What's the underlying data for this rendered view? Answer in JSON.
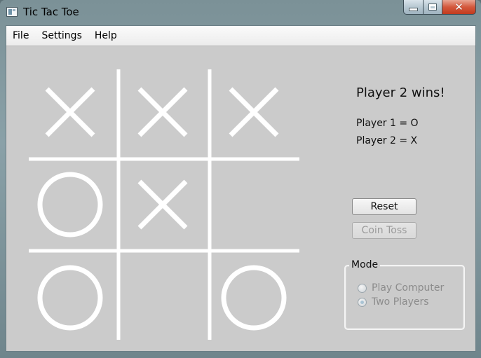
{
  "window": {
    "title": "Tic Tac Toe",
    "icon": "app-window-icon"
  },
  "menu": {
    "items": [
      "File",
      "Settings",
      "Help"
    ]
  },
  "board": {
    "cells": [
      [
        "X",
        "X",
        "X"
      ],
      [
        "O",
        "X",
        ""
      ],
      [
        "O",
        "",
        "O"
      ]
    ],
    "line_color": "#ffffff"
  },
  "status": {
    "message": "Player 2 wins!",
    "player1": "Player 1 = O",
    "player2": "Player 2 = X"
  },
  "buttons": {
    "reset": "Reset",
    "coin_toss": "Coin Toss"
  },
  "mode": {
    "legend": "Mode",
    "options": [
      {
        "label": "Play Computer",
        "selected": false
      },
      {
        "label": "Two Players",
        "selected": true
      }
    ]
  },
  "colors": {
    "background": "#cbcbcb",
    "marks": "#ffffff",
    "close_button": "#c7401f"
  }
}
